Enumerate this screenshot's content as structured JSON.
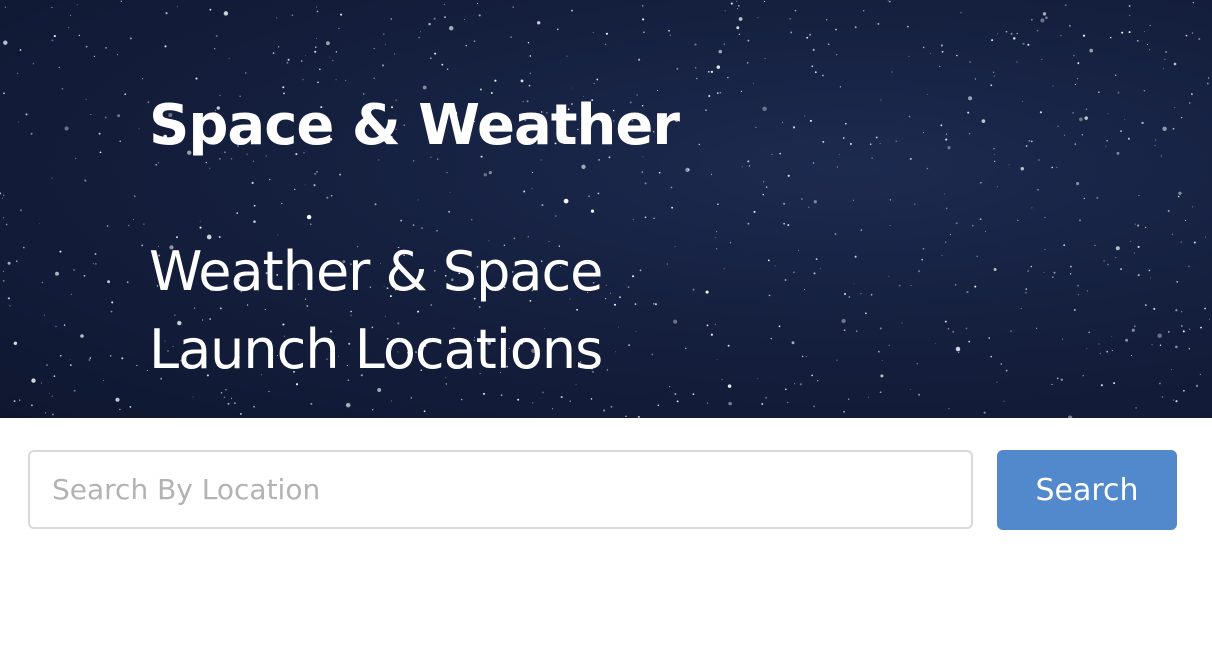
{
  "hero": {
    "title": "Space & Weather",
    "subtitle": "Weather & Space Launch Locations",
    "background": "starfield-night-sky"
  },
  "search": {
    "placeholder": "Search By Location",
    "value": "",
    "button_label": "Search"
  },
  "colors": {
    "hero_background": "#15203f",
    "button": "#5289cc",
    "input_border": "#d9d9d9",
    "placeholder": "#b3b3b3"
  }
}
